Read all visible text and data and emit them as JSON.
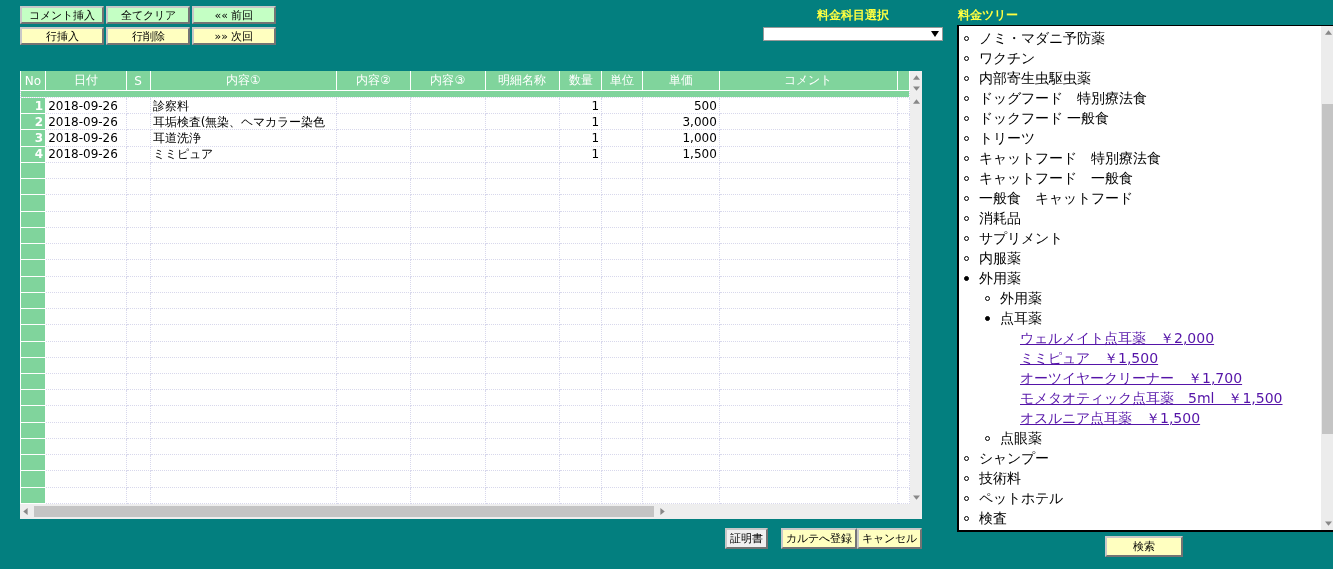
{
  "toolbar": [
    {
      "label": "コメント挿入",
      "kind": "green"
    },
    {
      "label": "全てクリア",
      "kind": "green"
    },
    {
      "label": "«« 前回",
      "kind": "green"
    },
    {
      "label": "行挿入",
      "kind": "yellow"
    },
    {
      "label": "行削除",
      "kind": "yellow"
    },
    {
      "label": "»» 次回",
      "kind": "yellow"
    }
  ],
  "category_select": {
    "label": "料金科目選択"
  },
  "grid": {
    "columns": [
      "No",
      "日付",
      "S",
      "内容①",
      "内容②",
      "内容③",
      "明細名称",
      "数量",
      "単位",
      "単価",
      "コメント"
    ],
    "rows": [
      {
        "no": "1",
        "date": "2018-09-26",
        "s": "",
        "content1": "診察料",
        "quantity": "1",
        "price": "500"
      },
      {
        "no": "2",
        "date": "2018-09-26",
        "s": "",
        "content1": "耳垢検査(無染、ヘマカラー染色",
        "quantity": "1",
        "price": "3,000"
      },
      {
        "no": "3",
        "date": "2018-09-26",
        "s": "",
        "content1": "耳道洗浄",
        "quantity": "1",
        "price": "1,000"
      },
      {
        "no": "4",
        "date": "2018-09-26",
        "s": "",
        "content1": "ミミピュア",
        "quantity": "1",
        "price": "1,500"
      }
    ]
  },
  "bottom_buttons": [
    {
      "label": "証明書",
      "kind": "grey"
    },
    {
      "label": "カルテへ登録",
      "kind": "yellow"
    },
    {
      "label": "キャンセル",
      "kind": "yellow"
    }
  ],
  "tree": {
    "title": "料金ツリー",
    "items": [
      {
        "label": "ノミ・マダニ予防薬",
        "expanded": false
      },
      {
        "label": "ワクチン",
        "expanded": false
      },
      {
        "label": "内部寄生虫駆虫薬",
        "expanded": false
      },
      {
        "label": "ドッグフード　特別療法食",
        "expanded": false
      },
      {
        "label": "ドックフード 一般食",
        "expanded": false
      },
      {
        "label": "トリーツ",
        "expanded": false
      },
      {
        "label": "キャットフード　特別療法食",
        "expanded": false
      },
      {
        "label": "キャットフード　一般食",
        "expanded": false
      },
      {
        "label": "一般食　キャットフード",
        "expanded": false
      },
      {
        "label": "消耗品",
        "expanded": false
      },
      {
        "label": "サプリメント",
        "expanded": false
      },
      {
        "label": "内服薬",
        "expanded": false
      },
      {
        "label": "外用薬",
        "expanded": true,
        "children": [
          {
            "label": "外用薬",
            "expanded": false
          },
          {
            "label": "点耳薬",
            "expanded": true,
            "children": [
              {
                "label": "ウェルメイト点耳薬　￥2,000",
                "kind": "link"
              },
              {
                "label": "ミミピュア　￥1,500",
                "kind": "link"
              },
              {
                "label": "オーツイヤークリーナー　￥1,700",
                "kind": "link"
              },
              {
                "label": "モメタオティック点耳薬　5ml　￥1,500",
                "kind": "link"
              },
              {
                "label": "オスルニア点耳薬　￥1,500",
                "kind": "link"
              }
            ]
          },
          {
            "label": "点眼薬",
            "expanded": false
          }
        ]
      },
      {
        "label": "シャンプー",
        "expanded": false
      },
      {
        "label": "技術料",
        "expanded": false
      },
      {
        "label": "ペットホテル",
        "expanded": false
      },
      {
        "label": "検査",
        "expanded": false
      }
    ]
  },
  "search_button": {
    "label": "検索"
  }
}
